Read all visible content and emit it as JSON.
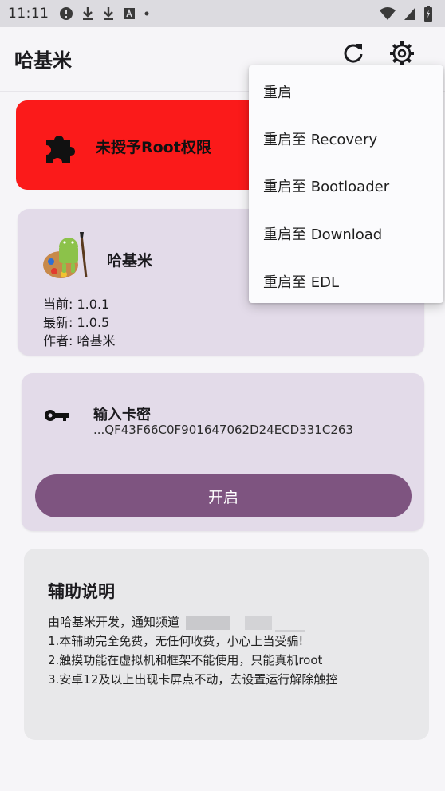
{
  "status_bar": {
    "time": "11:11",
    "icons": [
      "alert-circle-icon",
      "download-icon",
      "download-icon",
      "app-a-icon",
      "dot-icon"
    ],
    "right_icons": [
      "wifi-icon",
      "signal-icon",
      "battery-icon"
    ]
  },
  "app_bar": {
    "title": "哈基米",
    "actions": [
      "refresh-icon",
      "settings-gear-icon"
    ]
  },
  "root_card": {
    "label": "未授予Root权限",
    "icon": "puzzle-icon",
    "color": "#fb1a1a"
  },
  "app_card": {
    "name": "哈基米",
    "icon": "android-palette-icon",
    "current_label": "当前:",
    "current_value": "1.0.1",
    "latest_label": "最新:",
    "latest_value": "1.0.5",
    "author_label": "作者:",
    "author_value": "哈基米"
  },
  "key_card": {
    "title": "输入卡密",
    "value": "...QF43F66C0F901647062D24ECD331C263",
    "icon": "key-icon",
    "button_label": "开启",
    "button_color": "#7e5480"
  },
  "help_card": {
    "title": "辅助说明",
    "line_intro": "由哈基米开发，通知频道",
    "line_1": "1.本辅助完全免费，无任何收费，小心上当受骗!",
    "line_2": "2.触摸功能在虚拟机和框架不能使用，只能真机root",
    "line_3": "3.安卓12及以上出现卡屏点不动，去设置运行解除触控"
  },
  "reboot_menu": {
    "items": [
      {
        "label": "重启"
      },
      {
        "label": "重启至 Recovery"
      },
      {
        "label": "重启至 Bootloader"
      },
      {
        "label": "重启至 Download"
      },
      {
        "label": "重启至 EDL"
      }
    ]
  }
}
